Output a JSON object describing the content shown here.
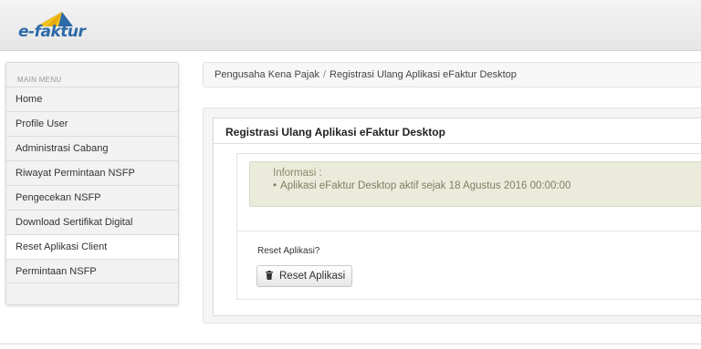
{
  "header": {
    "logo_text": "e-faktur"
  },
  "sidebar": {
    "heading": "MAIN MENU",
    "items": [
      {
        "label": "Home"
      },
      {
        "label": "Profile User"
      },
      {
        "label": "Administrasi Cabang"
      },
      {
        "label": "Riwayat Permintaan NSFP"
      },
      {
        "label": "Pengecekan NSFP"
      },
      {
        "label": "Download Sertifikat Digital"
      },
      {
        "label": "Reset Aplikasi Client"
      },
      {
        "label": "Permintaan NSFP"
      }
    ],
    "active_index": 6
  },
  "breadcrumb": {
    "items": [
      "Pengusaha Kena Pajak",
      "Registrasi Ulang Aplikasi eFaktur Desktop"
    ],
    "separator": "/"
  },
  "panel": {
    "title": "Registrasi Ulang Aplikasi eFaktur Desktop",
    "info": {
      "heading": "Informasi :",
      "items": [
        "Aplikasi eFaktur Desktop aktif sejak 18 Agustus 2016 00:00:00"
      ]
    },
    "reset": {
      "question": "Reset Aplikasi?",
      "button_label": "Reset Aplikasi",
      "button_icon": "trash-icon"
    }
  },
  "colors": {
    "logo_blue": "#2c6aa8",
    "logo_yellow": "#f2c21a",
    "alert_bg": "#ebebdc",
    "alert_text": "#8a8a6a"
  }
}
